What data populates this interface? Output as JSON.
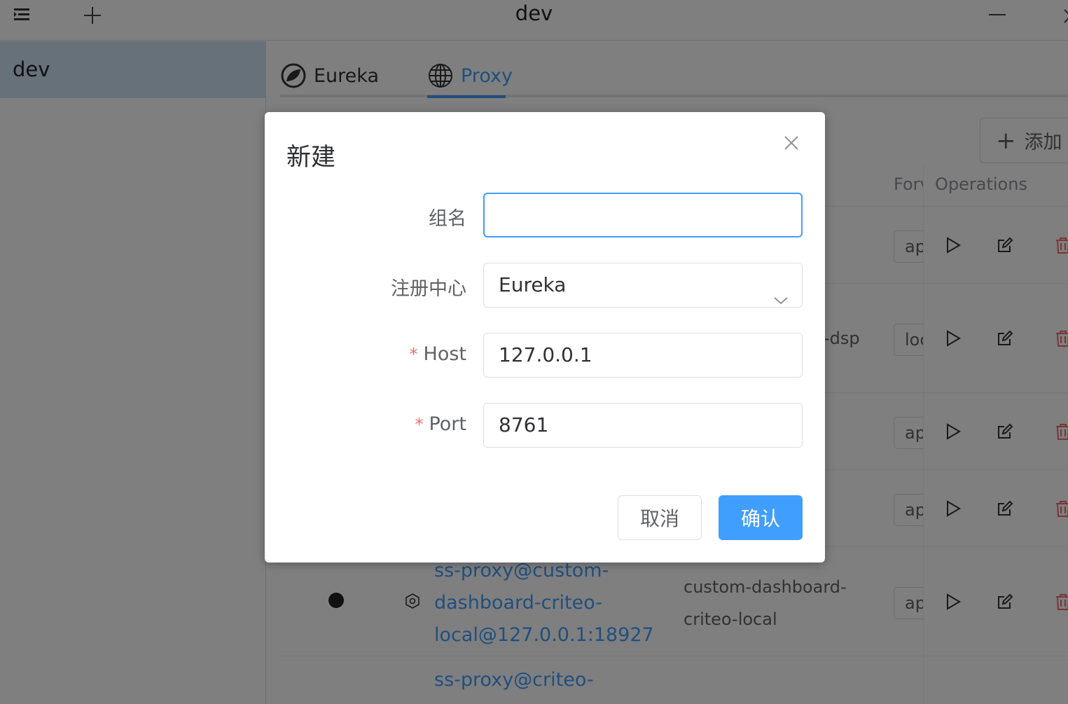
{
  "titlebar": {
    "title": "dev",
    "menu_icon": "menu-icon",
    "add_icon": "plus-icon",
    "minimize_icon": "minimize-icon",
    "close_icon": "close-icon"
  },
  "sidebar": {
    "items": [
      {
        "label": "dev",
        "selected": true
      }
    ]
  },
  "tabs": [
    {
      "label": "Eureka",
      "icon": "spring-leaf-icon",
      "active": false
    },
    {
      "label": "Proxy",
      "icon": "globe-icon",
      "active": true
    }
  ],
  "toolbar": {
    "add_label": "添加"
  },
  "table": {
    "headers": {
      "forward": "Forv",
      "operations": "Operations"
    },
    "rows": [
      {
        "forward_value": "ap"
      },
      {
        "forward_value": "loc",
        "service_partial": "-dsp"
      },
      {
        "forward_value": "ap"
      },
      {
        "forward_value": "ap"
      },
      {
        "name_lines": [
          "ss-proxy@custom-",
          "dashboard-criteo-",
          "local@127.0.0.1:18927"
        ],
        "service_lines": [
          "custom-dashboard-",
          "criteo-local"
        ],
        "forward_value": "ap"
      },
      {
        "name_lines": [
          "ss-proxy@criteo-"
        ]
      }
    ]
  },
  "dialog": {
    "title": "新建",
    "fields": {
      "group": {
        "label": "组名",
        "value": ""
      },
      "registry": {
        "label": "注册中心",
        "value": "Eureka"
      },
      "host": {
        "label": "Host",
        "required_mark": "*",
        "value": "127.0.0.1"
      },
      "port": {
        "label": "Port",
        "required_mark": "*",
        "value": "8761"
      }
    },
    "cancel_label": "取消",
    "confirm_label": "确认"
  },
  "colors": {
    "accent": "#409eff",
    "danger": "#f56c6c",
    "selected_bg": "#cfe2f5"
  }
}
